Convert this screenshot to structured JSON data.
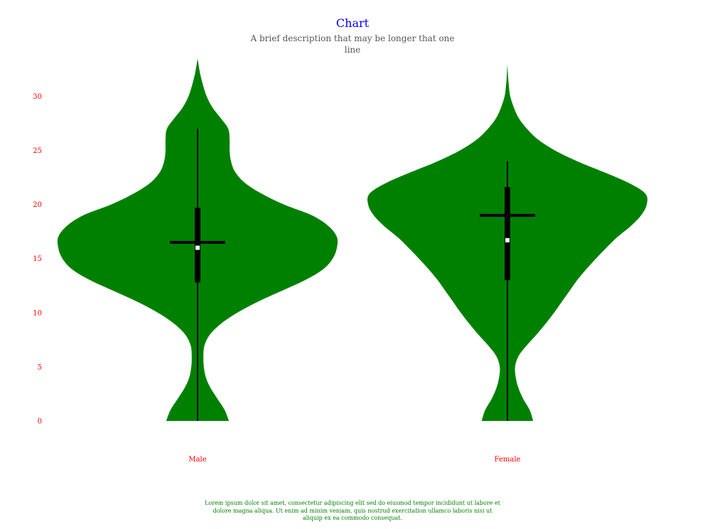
{
  "chart_data": {
    "type": "violin",
    "title": "Chart",
    "subtitle": "A brief description that may be longer that one line",
    "caption": "Lorem ipsum dolor sit amet, consectetur adipiscing elit sed do eiusmod tempor incididunt ut labore et dolore magna aliqua. Ut enim ad minim veniam, quis nostrud exercitation ullamco laboris nisi ut aliquip ex ea commodo consequat.",
    "categories": [
      "Male",
      "Female"
    ],
    "ylim": [
      0,
      33.5
    ],
    "yticks": [
      0,
      5,
      10,
      15,
      20,
      25,
      30
    ],
    "grid": false,
    "colors": {
      "violin": "#008000",
      "title": "#0000ff",
      "subtitle": "#555555",
      "ticks": "#ff0000",
      "caption": "#008000",
      "box": "#000000",
      "median": "#ffffff"
    },
    "series": [
      {
        "category": "Male",
        "whisker_low": 0,
        "whisker_high": 27,
        "q1": 12.8,
        "q3": 19.7,
        "median": 16,
        "mean": 16.5,
        "density": [
          [
            0,
            0.225
          ],
          [
            1,
            0.195
          ],
          [
            2,
            0.145
          ],
          [
            3,
            0.095
          ],
          [
            4,
            0.06
          ],
          [
            5,
            0.045
          ],
          [
            6,
            0.042
          ],
          [
            7,
            0.05
          ],
          [
            8,
            0.09
          ],
          [
            9,
            0.17
          ],
          [
            10,
            0.285
          ],
          [
            11,
            0.43
          ],
          [
            12,
            0.6
          ],
          [
            13,
            0.77
          ],
          [
            14,
            0.9
          ],
          [
            15,
            0.97
          ],
          [
            16,
            1.0
          ],
          [
            17,
            1.0
          ],
          [
            18,
            0.94
          ],
          [
            19,
            0.82
          ],
          [
            20,
            0.62
          ],
          [
            21,
            0.46
          ],
          [
            22,
            0.34
          ],
          [
            23,
            0.27
          ],
          [
            24,
            0.24
          ],
          [
            25,
            0.23
          ],
          [
            26,
            0.23
          ],
          [
            27,
            0.22
          ],
          [
            28,
            0.165
          ],
          [
            29,
            0.105
          ],
          [
            30,
            0.065
          ],
          [
            31,
            0.04
          ],
          [
            32,
            0.02
          ],
          [
            33,
            0.006
          ],
          [
            33.5,
            0
          ]
        ]
      },
      {
        "category": "Female",
        "whisker_low": 0,
        "whisker_high": 24,
        "q1": 13,
        "q3": 21.6,
        "median": 16.7,
        "mean": 19,
        "density": [
          [
            0,
            0.185
          ],
          [
            1,
            0.16
          ],
          [
            2,
            0.115
          ],
          [
            3,
            0.08
          ],
          [
            4,
            0.06
          ],
          [
            5,
            0.055
          ],
          [
            6,
            0.08
          ],
          [
            7,
            0.14
          ],
          [
            8,
            0.21
          ],
          [
            9,
            0.275
          ],
          [
            10,
            0.335
          ],
          [
            11,
            0.39
          ],
          [
            12,
            0.445
          ],
          [
            13,
            0.5
          ],
          [
            14,
            0.565
          ],
          [
            15,
            0.635
          ],
          [
            16,
            0.71
          ],
          [
            17,
            0.79
          ],
          [
            18,
            0.885
          ],
          [
            19,
            0.96
          ],
          [
            20,
            1.0
          ],
          [
            21,
            0.99
          ],
          [
            22,
            0.87
          ],
          [
            23,
            0.69
          ],
          [
            24,
            0.5
          ],
          [
            25,
            0.34
          ],
          [
            26,
            0.22
          ],
          [
            27,
            0.14
          ],
          [
            28,
            0.08
          ],
          [
            29,
            0.045
          ],
          [
            30,
            0.02
          ],
          [
            31,
            0.01
          ],
          [
            32,
            0.004
          ],
          [
            33,
            0
          ]
        ]
      }
    ]
  }
}
